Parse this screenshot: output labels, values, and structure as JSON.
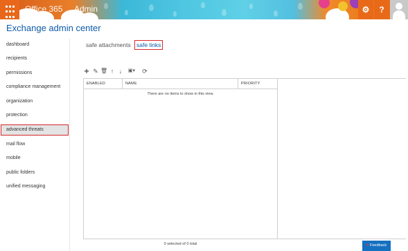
{
  "topbar": {
    "brand": "Office 365",
    "app_name": "Admin",
    "settings_symbol": "⚙",
    "help_symbol": "?",
    "icons": [
      "app-launcher-icon",
      "gear-icon",
      "help-icon",
      "user-avatar-icon"
    ]
  },
  "page_title": "Exchange admin center",
  "nav": {
    "items": [
      {
        "label": "dashboard",
        "selected": false
      },
      {
        "label": "recipients",
        "selected": false
      },
      {
        "label": "permissions",
        "selected": false
      },
      {
        "label": "compliance management",
        "selected": false
      },
      {
        "label": "organization",
        "selected": false
      },
      {
        "label": "protection",
        "selected": false
      },
      {
        "label": "advanced threats",
        "selected": true
      },
      {
        "label": "mail flow",
        "selected": false
      },
      {
        "label": "mobile",
        "selected": false
      },
      {
        "label": "public folders",
        "selected": false
      },
      {
        "label": "unified messaging",
        "selected": false
      }
    ]
  },
  "tabs": [
    {
      "label": "safe attachments",
      "active": false
    },
    {
      "label": "safe links",
      "active": true
    }
  ],
  "toolbar": {
    "icons": [
      "add-icon",
      "edit-icon",
      "delete-icon",
      "move-up-icon",
      "move-down-icon",
      "more-options-icon",
      "refresh-icon"
    ],
    "symbols": {
      "add": "+",
      "edit": "✎",
      "delete": "🗑",
      "up": "↑",
      "down": "↓",
      "more": "▣▾",
      "refresh": "⟳"
    }
  },
  "grid": {
    "columns": [
      "ENABLED",
      "NAME",
      "PRIORITY"
    ],
    "rows": [],
    "empty_message": "There are no items to show in this view.",
    "status": "0 selected of 0 total"
  },
  "feedback": {
    "label": "Feedback",
    "heart": "♥"
  },
  "colors": {
    "accent": "#0b5aa8",
    "highlight_border": "#d8252b",
    "topbar_orange": "#e86a18",
    "feedback_blue": "#1570c0"
  }
}
